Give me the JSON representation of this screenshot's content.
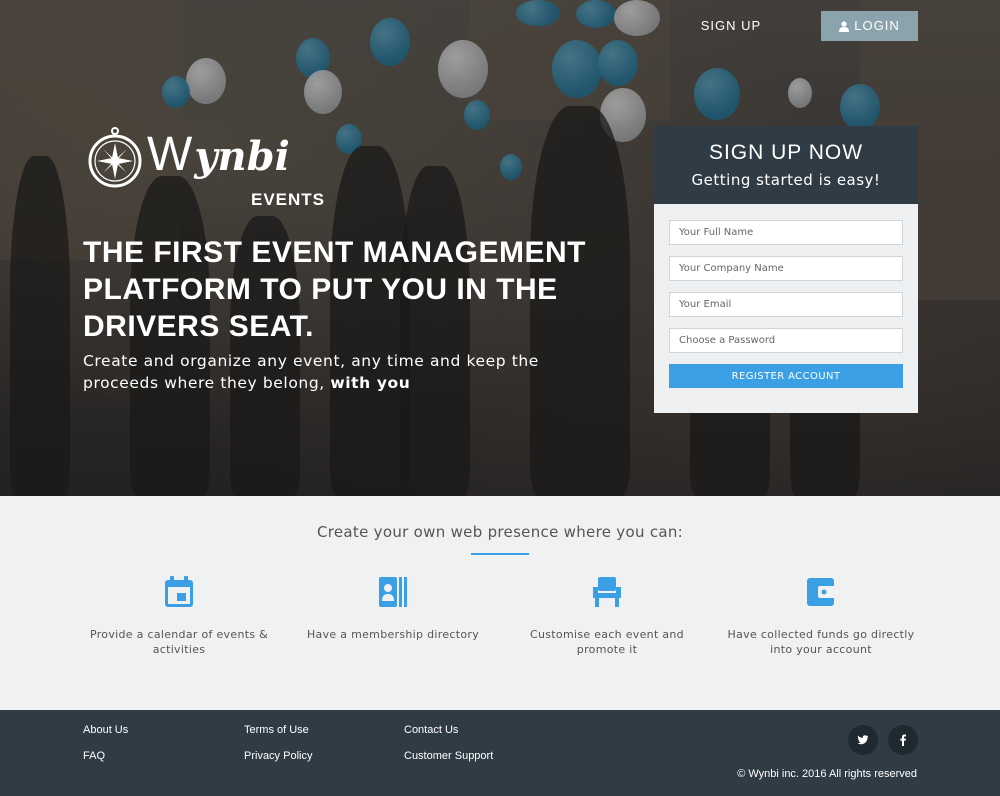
{
  "nav": {
    "signup_label": "SIGN UP",
    "login_label": "LOGIN"
  },
  "logo": {
    "word_initial": "W",
    "word_rest": "ynbi",
    "sub": "EVENTS"
  },
  "hero": {
    "headline": "THE FIRST EVENT MANAGEMENT PLATFORM TO PUT YOU IN THE DRIVERS SEAT.",
    "subhead_prefix": "Create and organize any event, any time and keep the proceeds where they belong, ",
    "subhead_bold": "with you"
  },
  "signup_card": {
    "title": "SIGN UP NOW",
    "subtitle": "Getting started is easy!",
    "fields": {
      "full_name_placeholder": "Your Full Name",
      "company_placeholder": "Your Company Name",
      "email_placeholder": "Your Email",
      "password_placeholder": "Choose a Password"
    },
    "register_label": "REGISTER ACCOUNT"
  },
  "features": {
    "title": "Create your own web presence where you can:",
    "items": [
      {
        "icon": "calendar-icon",
        "text": "Provide a calendar of events & activities"
      },
      {
        "icon": "membership-directory-icon",
        "text": "Have a membership directory"
      },
      {
        "icon": "chair-icon",
        "text": "Customise each event and promote it"
      },
      {
        "icon": "wallet-icon",
        "text": "Have collected funds go directly into your account"
      }
    ]
  },
  "footer": {
    "links": {
      "about": "About Us",
      "faq": "FAQ",
      "terms": "Terms of Use",
      "privacy": "Privacy Policy",
      "contact": "Contact Us",
      "support": "Customer Support"
    },
    "social": [
      "twitter-icon",
      "facebook-icon"
    ],
    "copyright": "© Wynbi inc. 2016 All rights reserved"
  },
  "colors": {
    "accent": "#3a9fe4",
    "dark": "#2f3c45",
    "login_bg": "#8aa3ad"
  }
}
